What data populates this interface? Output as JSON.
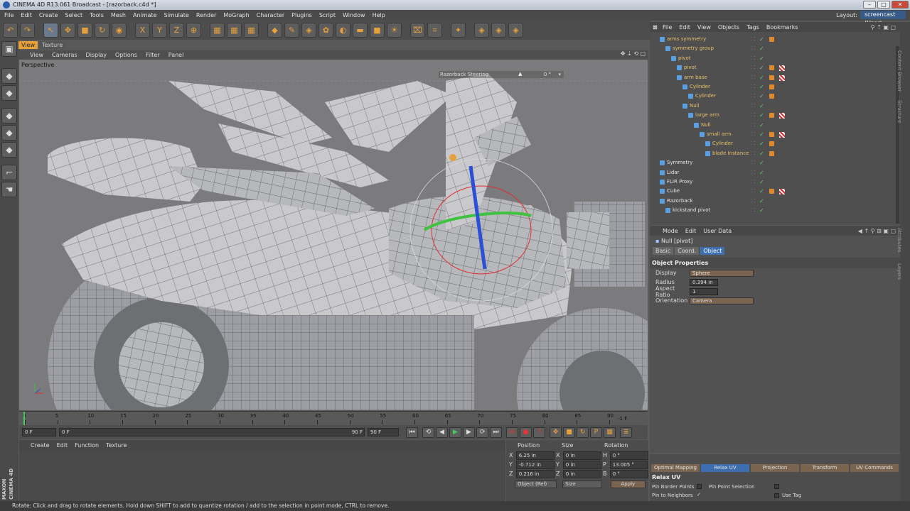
{
  "window": {
    "title": "CINEMA 4D R13.061 Broadcast - [razorback.c4d *]",
    "min": "–",
    "max": "□",
    "close": "✕"
  },
  "menu": [
    "File",
    "Edit",
    "Create",
    "Select",
    "Tools",
    "Mesh",
    "Animate",
    "Simulate",
    "Render",
    "MoGraph",
    "Character",
    "Plugins",
    "Script",
    "Window",
    "Help"
  ],
  "layout": {
    "label": "Layout:",
    "value": "screencast (User)"
  },
  "viewport": {
    "tabs": [
      "View",
      "Texture"
    ],
    "menu": [
      "View",
      "Cameras",
      "Display",
      "Options",
      "Filter",
      "Panel"
    ],
    "label": "Perspective",
    "hud": "Razorback Steering",
    "hud_value": "0 °"
  },
  "timeline": {
    "ticks": [
      "0",
      "5",
      "10",
      "15",
      "20",
      "25",
      "30",
      "35",
      "40",
      "45",
      "50",
      "55",
      "60",
      "65",
      "70",
      "75",
      "80",
      "85",
      "90"
    ],
    "end_label": "-1 F",
    "current": "0 F",
    "start": "0 F",
    "range_end": "90 F",
    "max": "90 F"
  },
  "material_manager": {
    "menu": [
      "Create",
      "Edit",
      "Function",
      "Texture"
    ]
  },
  "coordinates": {
    "headers": [
      "Position",
      "Size",
      "Rotation"
    ],
    "rows": [
      {
        "axis": "X",
        "pos": "6.25 in",
        "size_axis": "X",
        "size": "0 in",
        "rot_axis": "H",
        "rot": "0 °"
      },
      {
        "axis": "Y",
        "pos": "-0.712 in",
        "size_axis": "Y",
        "size": "0 in",
        "rot_axis": "P",
        "rot": "13.005 °"
      },
      {
        "axis": "Z",
        "pos": "0.216 in",
        "size_axis": "Z",
        "size": "0 in",
        "rot_axis": "B",
        "rot": "0 °"
      }
    ],
    "mode": "Object (Rel)",
    "size_mode": "Size",
    "apply": "Apply"
  },
  "brand": {
    "line1": "MAXON",
    "line2": "CINEMA 4D"
  },
  "object_manager": {
    "menu": [
      "File",
      "Edit",
      "View",
      "Objects",
      "Tags",
      "Bookmarks"
    ],
    "objects": [
      {
        "name": "arms symmetry",
        "indent": 1,
        "sel": true,
        "tagA": true,
        "tagB": false
      },
      {
        "name": "symmetry group",
        "indent": 2,
        "sel": true,
        "tagA": false,
        "tagB": false
      },
      {
        "name": "pivot",
        "indent": 3,
        "sel": true,
        "tagA": false,
        "tagB": false
      },
      {
        "name": "pivot",
        "indent": 4,
        "sel": true,
        "tagA": true,
        "tagB": true
      },
      {
        "name": "arm base",
        "indent": 4,
        "sel": true,
        "tagA": true,
        "tagB": true
      },
      {
        "name": "Cylinder",
        "indent": 5,
        "sel": true,
        "tagA": true,
        "tagB": false
      },
      {
        "name": "Cylinder",
        "indent": 6,
        "sel": true,
        "tagA": true,
        "tagB": false
      },
      {
        "name": "Null",
        "indent": 5,
        "sel": true,
        "tagA": false,
        "tagB": false
      },
      {
        "name": "large arm",
        "indent": 6,
        "sel": true,
        "tagA": true,
        "tagB": true
      },
      {
        "name": "Null",
        "indent": 7,
        "sel": true,
        "tagA": false,
        "tagB": false
      },
      {
        "name": "small arm",
        "indent": 8,
        "sel": true,
        "tagA": true,
        "tagB": true
      },
      {
        "name": "Cylinder",
        "indent": 9,
        "sel": true,
        "tagA": true,
        "tagB": false
      },
      {
        "name": "blade Instance",
        "indent": 9,
        "sel": true,
        "tagA": true,
        "tagB": false
      },
      {
        "name": "Symmetry",
        "indent": 1,
        "sel": false,
        "tagA": false,
        "tagB": false
      },
      {
        "name": "Lidar",
        "indent": 1,
        "sel": false,
        "tagA": false,
        "tagB": false
      },
      {
        "name": "FLIR Proxy",
        "indent": 1,
        "sel": false,
        "tagA": false,
        "tagB": false
      },
      {
        "name": "Cube",
        "indent": 1,
        "sel": false,
        "tagA": true,
        "tagB": true
      },
      {
        "name": "Razorback",
        "indent": 1,
        "sel": false,
        "tagA": false,
        "tagB": false
      },
      {
        "name": "kickstand pivot",
        "indent": 2,
        "sel": false,
        "tagA": false,
        "tagB": false
      }
    ]
  },
  "attributes": {
    "menu": [
      "Mode",
      "Edit",
      "User Data"
    ],
    "title": "Null [pivot]",
    "tabs": [
      "Basic",
      "Coord.",
      "Object"
    ],
    "section": "Object Properties",
    "fields": [
      {
        "label": "Display",
        "value": "Sphere",
        "type": "dropdown"
      },
      {
        "label": "Radius",
        "value": "0.394 in",
        "type": "number"
      },
      {
        "label": "Aspect Ratio",
        "value": "1",
        "type": "number"
      },
      {
        "label": "Orientation",
        "value": "Camera",
        "type": "dropdown"
      }
    ]
  },
  "relax_panel": {
    "tabs": [
      "Optimal Mapping",
      "Relax UV",
      "Projection",
      "Transform",
      "UV Commands"
    ],
    "title": "Relax UV",
    "options": [
      "Pin Border Points",
      "Pin to Neighbors",
      "Pin Point Selection",
      "Use Tag"
    ]
  },
  "right_strip": [
    "Content Browser",
    "Structure",
    "Attributes",
    "Layers"
  ],
  "status": "Rotate: Click and drag to rotate elements. Hold down SHIFT to add to quantize rotation / add to the selection in point mode, CTRL to remove.",
  "colors": {
    "accent": "#e8a13a",
    "selection_blue": "#3d6fb0",
    "object_name": "#e8c26a",
    "x_axis": "#3fc23f",
    "y_axis": "#2b4fd8",
    "z_axis": "#e03030"
  }
}
